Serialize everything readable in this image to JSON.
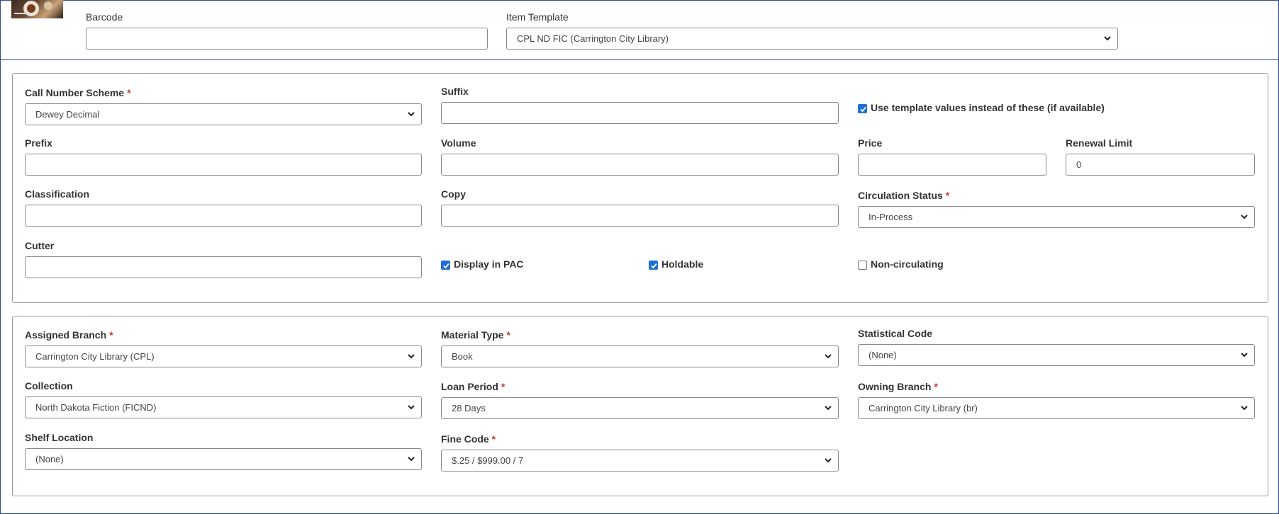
{
  "header": {
    "barcode_label": "Barcode",
    "barcode_value": "",
    "item_template_label": "Item Template",
    "item_template_value": "CPL ND FIC (Carrington City Library)"
  },
  "callnumber": {
    "scheme_label": "Call Number Scheme",
    "scheme_value": "Dewey Decimal",
    "suffix_label": "Suffix",
    "suffix_value": "",
    "use_template_label": "Use template values instead of these (if available)",
    "use_template_checked": true,
    "prefix_label": "Prefix",
    "prefix_value": "",
    "volume_label": "Volume",
    "volume_value": "",
    "price_label": "Price",
    "price_value": "",
    "renewal_label": "Renewal Limit",
    "renewal_value": "0",
    "classification_label": "Classification",
    "classification_value": "",
    "copy_label": "Copy",
    "copy_value": "",
    "circ_status_label": "Circulation Status",
    "circ_status_value": "In-Process",
    "cutter_label": "Cutter",
    "cutter_value": "",
    "display_pac_label": "Display in PAC",
    "display_pac_checked": true,
    "holdable_label": "Holdable",
    "holdable_checked": true,
    "noncirc_label": "Non-circulating",
    "noncirc_checked": false
  },
  "item": {
    "assigned_branch_label": "Assigned Branch",
    "assigned_branch_value": "Carrington City Library (CPL)",
    "material_type_label": "Material Type",
    "material_type_value": "Book",
    "stat_code_label": "Statistical Code",
    "stat_code_value": "(None)",
    "collection_label": "Collection",
    "collection_value": "North Dakota Fiction (FICND)",
    "loan_period_label": "Loan Period",
    "loan_period_value": "28 Days",
    "owning_branch_label": "Owning Branch",
    "owning_branch_value": "Carrington City Library (br)",
    "shelf_location_label": "Shelf Location",
    "shelf_location_value": "(None)",
    "fine_code_label": "Fine Code",
    "fine_code_value": "$.25 / $999.00 / 7"
  },
  "colors": {
    "accent": "#1e6fd9",
    "required": "#c0392b",
    "frame": "#2f4a8a"
  }
}
